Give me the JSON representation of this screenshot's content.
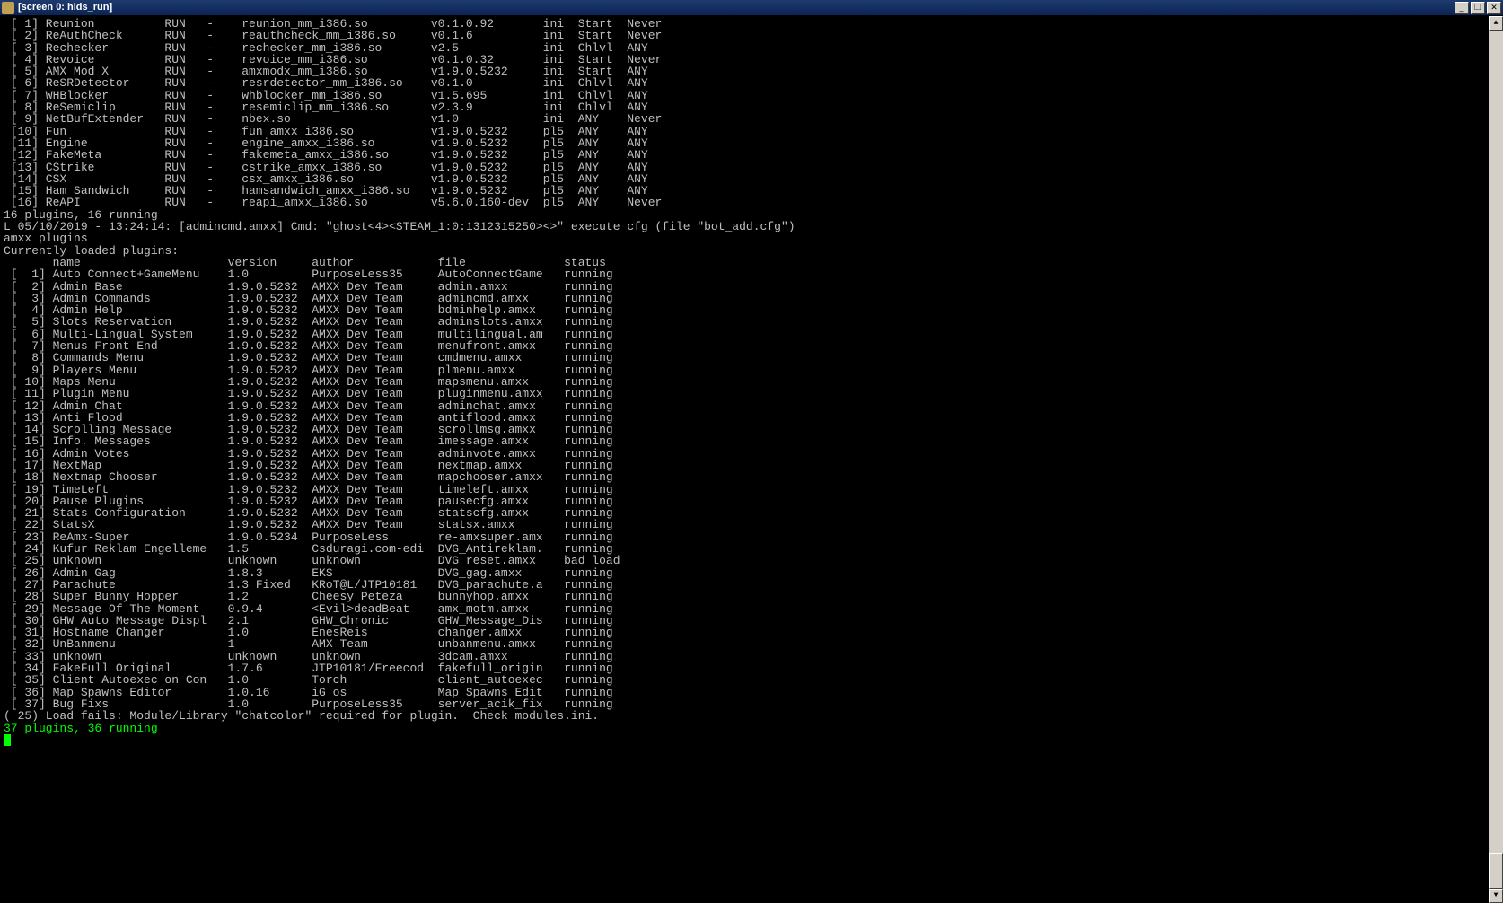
{
  "window": {
    "title": "[screen 0: hlds_run]"
  },
  "meta_table": {
    "rows": [
      {
        "idx": "[ 1]",
        "name": "Reunion",
        "stat": "RUN",
        "dash": "-",
        "file": "reunion_mm_i386.so",
        "ver": "v0.1.0.92",
        "src": "ini",
        "load": "Start",
        "unload": "Never"
      },
      {
        "idx": "[ 2]",
        "name": "ReAuthCheck",
        "stat": "RUN",
        "dash": "-",
        "file": "reauthcheck_mm_i386.so",
        "ver": "v0.1.6",
        "src": "ini",
        "load": "Start",
        "unload": "Never"
      },
      {
        "idx": "[ 3]",
        "name": "Rechecker",
        "stat": "RUN",
        "dash": "-",
        "file": "rechecker_mm_i386.so",
        "ver": "v2.5",
        "src": "ini",
        "load": "Chlvl",
        "unload": "ANY"
      },
      {
        "idx": "[ 4]",
        "name": "Revoice",
        "stat": "RUN",
        "dash": "-",
        "file": "revoice_mm_i386.so",
        "ver": "v0.1.0.32",
        "src": "ini",
        "load": "Start",
        "unload": "Never"
      },
      {
        "idx": "[ 5]",
        "name": "AMX Mod X",
        "stat": "RUN",
        "dash": "-",
        "file": "amxmodx_mm_i386.so",
        "ver": "v1.9.0.5232",
        "src": "ini",
        "load": "Start",
        "unload": "ANY"
      },
      {
        "idx": "[ 6]",
        "name": "ReSRDetector",
        "stat": "RUN",
        "dash": "-",
        "file": "resrdetector_mm_i386.so",
        "ver": "v0.1.0",
        "src": "ini",
        "load": "Chlvl",
        "unload": "ANY"
      },
      {
        "idx": "[ 7]",
        "name": "WHBlocker",
        "stat": "RUN",
        "dash": "-",
        "file": "whblocker_mm_i386.so",
        "ver": "v1.5.695",
        "src": "ini",
        "load": "Chlvl",
        "unload": "ANY"
      },
      {
        "idx": "[ 8]",
        "name": "ReSemiclip",
        "stat": "RUN",
        "dash": "-",
        "file": "resemiclip_mm_i386.so",
        "ver": "v2.3.9",
        "src": "ini",
        "load": "Chlvl",
        "unload": "ANY"
      },
      {
        "idx": "[ 9]",
        "name": "NetBufExtender",
        "stat": "RUN",
        "dash": "-",
        "file": "nbex.so",
        "ver": "v1.0",
        "src": "ini",
        "load": "ANY",
        "unload": "Never"
      },
      {
        "idx": "[10]",
        "name": "Fun",
        "stat": "RUN",
        "dash": "-",
        "file": "fun_amxx_i386.so",
        "ver": "v1.9.0.5232",
        "src": "pl5",
        "load": "ANY",
        "unload": "ANY"
      },
      {
        "idx": "[11]",
        "name": "Engine",
        "stat": "RUN",
        "dash": "-",
        "file": "engine_amxx_i386.so",
        "ver": "v1.9.0.5232",
        "src": "pl5",
        "load": "ANY",
        "unload": "ANY"
      },
      {
        "idx": "[12]",
        "name": "FakeMeta",
        "stat": "RUN",
        "dash": "-",
        "file": "fakemeta_amxx_i386.so",
        "ver": "v1.9.0.5232",
        "src": "pl5",
        "load": "ANY",
        "unload": "ANY"
      },
      {
        "idx": "[13]",
        "name": "CStrike",
        "stat": "RUN",
        "dash": "-",
        "file": "cstrike_amxx_i386.so",
        "ver": "v1.9.0.5232",
        "src": "pl5",
        "load": "ANY",
        "unload": "ANY"
      },
      {
        "idx": "[14]",
        "name": "CSX",
        "stat": "RUN",
        "dash": "-",
        "file": "csx_amxx_i386.so",
        "ver": "v1.9.0.5232",
        "src": "pl5",
        "load": "ANY",
        "unload": "ANY"
      },
      {
        "idx": "[15]",
        "name": "Ham Sandwich",
        "stat": "RUN",
        "dash": "-",
        "file": "hamsandwich_amxx_i386.so",
        "ver": "v1.9.0.5232",
        "src": "pl5",
        "load": "ANY",
        "unload": "ANY"
      },
      {
        "idx": "[16]",
        "name": "ReAPI",
        "stat": "RUN",
        "dash": "-",
        "file": "reapi_amxx_i386.so",
        "ver": "v5.6.0.160-dev",
        "src": "pl5",
        "load": "ANY",
        "unload": "Never"
      }
    ],
    "summary": "16 plugins, 16 running"
  },
  "log_line": "L 05/10/2019 - 13:24:14: [admincmd.amxx] Cmd: \"ghost<4><STEAM_1:0:1312315250><>\" execute cfg (file \"bot_add.cfg\")",
  "cmd": "amxx plugins",
  "amxx_header": "Currently loaded plugins:",
  "amxx_cols": {
    "c1": "name",
    "c2": "version",
    "c3": "author",
    "c4": "file",
    "c5": "status"
  },
  "amxx": {
    "rows": [
      {
        "idx": "[  1]",
        "name": "Auto Connect+GameMenu",
        "ver": "1.0",
        "author": "PurposeLess35",
        "file": "AutoConnectGame",
        "status": "running"
      },
      {
        "idx": "[  2]",
        "name": "Admin Base",
        "ver": "1.9.0.5232",
        "author": "AMXX Dev Team",
        "file": "admin.amxx",
        "status": "running"
      },
      {
        "idx": "[  3]",
        "name": "Admin Commands",
        "ver": "1.9.0.5232",
        "author": "AMXX Dev Team",
        "file": "admincmd.amxx",
        "status": "running"
      },
      {
        "idx": "[  4]",
        "name": "Admin Help",
        "ver": "1.9.0.5232",
        "author": "AMXX Dev Team",
        "file": "bdminhelp.amxx",
        "status": "running"
      },
      {
        "idx": "[  5]",
        "name": "Slots Reservation",
        "ver": "1.9.0.5232",
        "author": "AMXX Dev Team",
        "file": "adminslots.amxx",
        "status": "running"
      },
      {
        "idx": "[  6]",
        "name": "Multi-Lingual System",
        "ver": "1.9.0.5232",
        "author": "AMXX Dev Team",
        "file": "multilingual.am",
        "status": "running"
      },
      {
        "idx": "[  7]",
        "name": "Menus Front-End",
        "ver": "1.9.0.5232",
        "author": "AMXX Dev Team",
        "file": "menufront.amxx",
        "status": "running"
      },
      {
        "idx": "[  8]",
        "name": "Commands Menu",
        "ver": "1.9.0.5232",
        "author": "AMXX Dev Team",
        "file": "cmdmenu.amxx",
        "status": "running"
      },
      {
        "idx": "[  9]",
        "name": "Players Menu",
        "ver": "1.9.0.5232",
        "author": "AMXX Dev Team",
        "file": "plmenu.amxx",
        "status": "running"
      },
      {
        "idx": "[ 10]",
        "name": "Maps Menu",
        "ver": "1.9.0.5232",
        "author": "AMXX Dev Team",
        "file": "mapsmenu.amxx",
        "status": "running"
      },
      {
        "idx": "[ 11]",
        "name": "Plugin Menu",
        "ver": "1.9.0.5232",
        "author": "AMXX Dev Team",
        "file": "pluginmenu.amxx",
        "status": "running"
      },
      {
        "idx": "[ 12]",
        "name": "Admin Chat",
        "ver": "1.9.0.5232",
        "author": "AMXX Dev Team",
        "file": "adminchat.amxx",
        "status": "running"
      },
      {
        "idx": "[ 13]",
        "name": "Anti Flood",
        "ver": "1.9.0.5232",
        "author": "AMXX Dev Team",
        "file": "antiflood.amxx",
        "status": "running"
      },
      {
        "idx": "[ 14]",
        "name": "Scrolling Message",
        "ver": "1.9.0.5232",
        "author": "AMXX Dev Team",
        "file": "scrollmsg.amxx",
        "status": "running"
      },
      {
        "idx": "[ 15]",
        "name": "Info. Messages",
        "ver": "1.9.0.5232",
        "author": "AMXX Dev Team",
        "file": "imessage.amxx",
        "status": "running"
      },
      {
        "idx": "[ 16]",
        "name": "Admin Votes",
        "ver": "1.9.0.5232",
        "author": "AMXX Dev Team",
        "file": "adminvote.amxx",
        "status": "running"
      },
      {
        "idx": "[ 17]",
        "name": "NextMap",
        "ver": "1.9.0.5232",
        "author": "AMXX Dev Team",
        "file": "nextmap.amxx",
        "status": "running"
      },
      {
        "idx": "[ 18]",
        "name": "Nextmap Chooser",
        "ver": "1.9.0.5232",
        "author": "AMXX Dev Team",
        "file": "mapchooser.amxx",
        "status": "running"
      },
      {
        "idx": "[ 19]",
        "name": "TimeLeft",
        "ver": "1.9.0.5232",
        "author": "AMXX Dev Team",
        "file": "timeleft.amxx",
        "status": "running"
      },
      {
        "idx": "[ 20]",
        "name": "Pause Plugins",
        "ver": "1.9.0.5232",
        "author": "AMXX Dev Team",
        "file": "pausecfg.amxx",
        "status": "running"
      },
      {
        "idx": "[ 21]",
        "name": "Stats Configuration",
        "ver": "1.9.0.5232",
        "author": "AMXX Dev Team",
        "file": "statscfg.amxx",
        "status": "running"
      },
      {
        "idx": "[ 22]",
        "name": "StatsX",
        "ver": "1.9.0.5232",
        "author": "AMXX Dev Team",
        "file": "statsx.amxx",
        "status": "running"
      },
      {
        "idx": "[ 23]",
        "name": "ReAmx-Super",
        "ver": "1.9.0.5234",
        "author": "PurposeLess",
        "file": "re-amxsuper.amx",
        "status": "running"
      },
      {
        "idx": "[ 24]",
        "name": "Kufur Reklam Engelleme",
        "ver": "1.5",
        "author": "Csduragi.com-edi",
        "file": "DVG_Antireklam.",
        "status": "running"
      },
      {
        "idx": "[ 25]",
        "name": "unknown",
        "ver": "unknown",
        "author": "unknown",
        "file": "DVG_reset.amxx",
        "status": "bad load"
      },
      {
        "idx": "[ 26]",
        "name": "Admin Gag",
        "ver": "1.8.3",
        "author": "EKS",
        "file": "DVG_gag.amxx",
        "status": "running"
      },
      {
        "idx": "[ 27]",
        "name": "Parachute",
        "ver": "1.3 Fixed",
        "author": "KRoT@L/JTP10181",
        "file": "DVG_parachute.a",
        "status": "running"
      },
      {
        "idx": "[ 28]",
        "name": "Super Bunny Hopper",
        "ver": "1.2",
        "author": "Cheesy Peteza",
        "file": "bunnyhop.amxx",
        "status": "running"
      },
      {
        "idx": "[ 29]",
        "name": "Message Of The Moment",
        "ver": "0.9.4",
        "author": "<Evil>deadBeat",
        "file": "amx_motm.amxx",
        "status": "running"
      },
      {
        "idx": "[ 30]",
        "name": "GHW Auto Message Displ",
        "ver": "2.1",
        "author": "GHW_Chronic",
        "file": "GHW_Message_Dis",
        "status": "running"
      },
      {
        "idx": "[ 31]",
        "name": "Hostname Changer",
        "ver": "1.0",
        "author": "EnesReis",
        "file": "changer.amxx",
        "status": "running"
      },
      {
        "idx": "[ 32]",
        "name": "UnBanmenu",
        "ver": "1",
        "author": "AMX Team",
        "file": "unbanmenu.amxx",
        "status": "running"
      },
      {
        "idx": "[ 33]",
        "name": "unknown",
        "ver": "unknown",
        "author": "unknown",
        "file": "3dcam.amxx",
        "status": "running"
      },
      {
        "idx": "[ 34]",
        "name": "FakeFull Original",
        "ver": "1.7.6",
        "author": "JTP10181/Freecod",
        "file": "fakefull_origin",
        "status": "running"
      },
      {
        "idx": "[ 35]",
        "name": "Client Autoexec on Con",
        "ver": "1.0",
        "author": "Torch",
        "file": "client_autoexec",
        "status": "running"
      },
      {
        "idx": "[ 36]",
        "name": "Map Spawns Editor",
        "ver": "1.0.16",
        "author": "iG_os",
        "file": "Map_Spawns_Edit",
        "status": "running"
      },
      {
        "idx": "[ 37]",
        "name": "Bug Fixs",
        "ver": "1.0",
        "author": "PurposeLess35",
        "file": "server_acik_fix",
        "status": "running"
      }
    ],
    "fail_line": "( 25) Load fails: Module/Library \"chatcolor\" required for plugin.  Check modules.ini.",
    "summary": "37 plugins, 36 running"
  }
}
